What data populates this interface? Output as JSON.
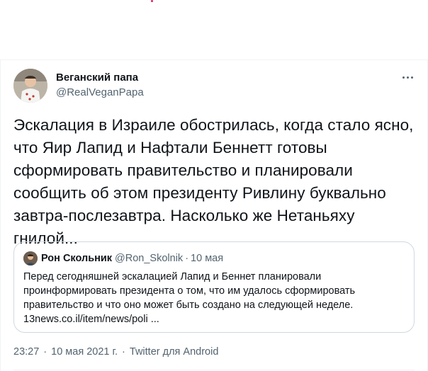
{
  "tweet": {
    "author": {
      "display_name": "Веганский папа",
      "handle": "@RealVeganPapa"
    },
    "text_lines": [
      "Эскалация в Израиле обострилась, когда стало ясно,",
      "что Яир Лапид и Нафтали Беннетт готовы",
      "сформировать правительство и планировали",
      "сообщить об этом президенту Ривлину буквально",
      "завтра-послезавтра. Насколько же Нетаньяху",
      "гнилой..."
    ],
    "quoted": {
      "author_name": "Рон Скольник",
      "handle": "@Ron_Skolnik",
      "separator": "·",
      "time": "10 мая",
      "text_lines": [
        "Перед сегодняшней эскалацией Лапид и Беннет планировали",
        "проинформировать президента о том, что им удалось сформировать",
        "правительство и что оно может быть создано на следующей неделе.",
        "13news.co.il/item/news/poli ..."
      ]
    },
    "meta": {
      "time": "23:27",
      "date": "10 мая 2021 г.",
      "separator": "·",
      "source": "Twitter для Android"
    }
  },
  "icons": {
    "more": "more-horizontal-icon",
    "avatar": "avatar",
    "quoted_avatar": "avatar"
  },
  "colors": {
    "text_primary": "#0f1419",
    "text_secondary": "#536471",
    "border": "#cfd9de",
    "divider": "#eff3f4"
  }
}
